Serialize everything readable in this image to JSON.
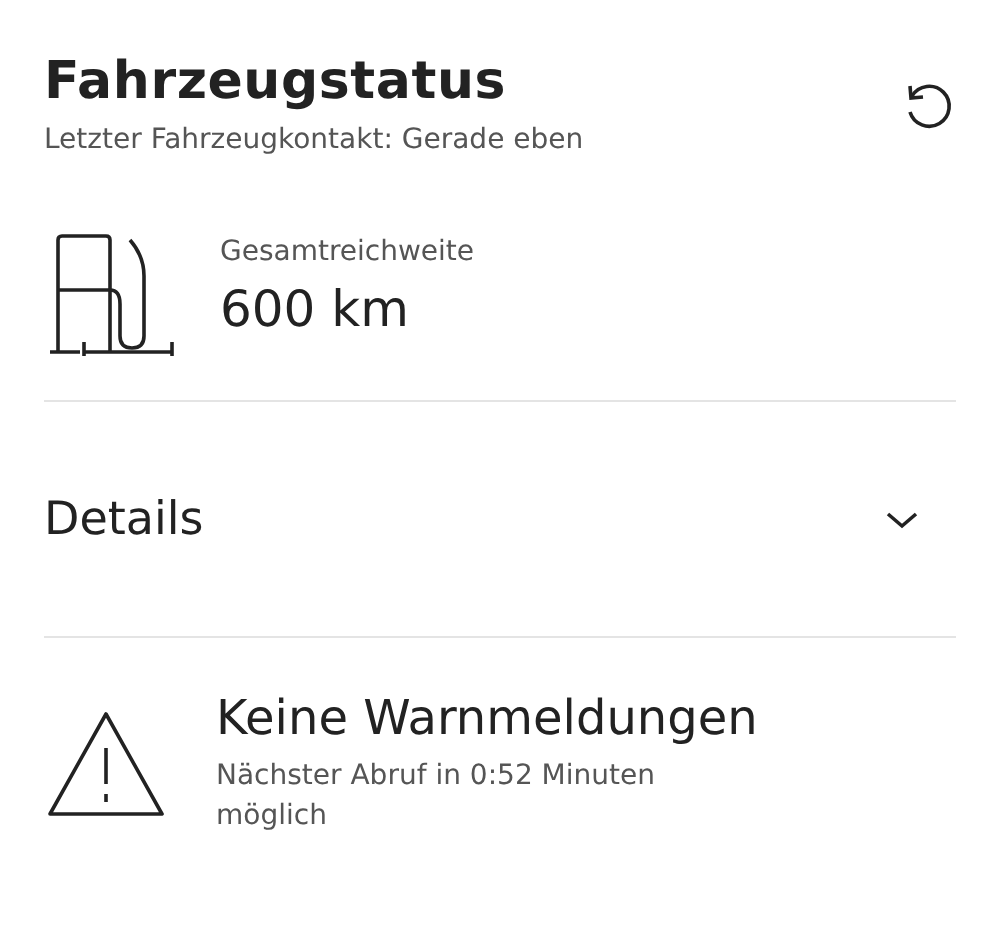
{
  "header": {
    "title": "Fahrzeugstatus",
    "subtitle": "Letzter Fahrzeugkontakt: Gerade eben"
  },
  "range": {
    "label": "Gesamtreichweite",
    "value": "600 km"
  },
  "details": {
    "label": "Details",
    "expanded": false
  },
  "warnings": {
    "title": "Keine Warnmeldungen",
    "text": "Nächster Abruf in 0:52 Minuten möglich"
  }
}
